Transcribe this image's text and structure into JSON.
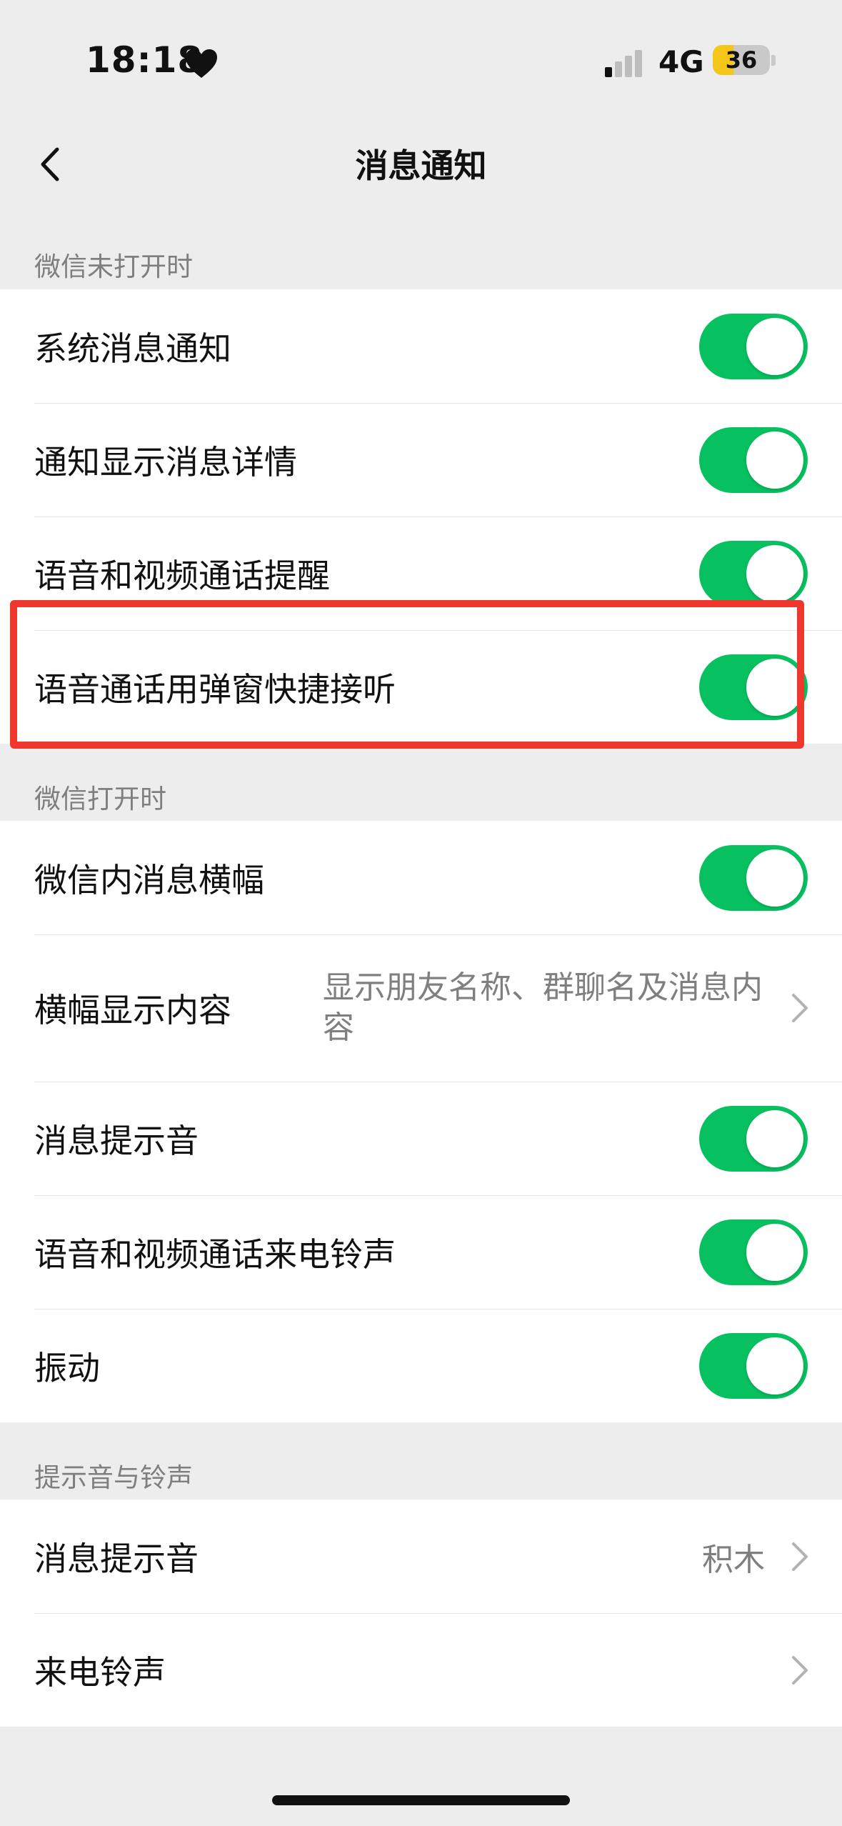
{
  "status_bar": {
    "time": "18:18",
    "network": "4G",
    "battery": "36",
    "battery_level": 0.36
  },
  "nav": {
    "title": "消息通知"
  },
  "sections": [
    {
      "header": "微信未打开时",
      "rows": [
        {
          "label": "系统消息通知",
          "toggle": true
        },
        {
          "label": "通知显示消息详情",
          "toggle": true
        },
        {
          "label": "语音和视频通话提醒",
          "toggle": true
        },
        {
          "label": "语音通话用弹窗快捷接听",
          "toggle": true
        }
      ]
    },
    {
      "header": "微信打开时",
      "rows": [
        {
          "label": "微信内消息横幅",
          "toggle": true
        },
        {
          "label": "横幅显示内容",
          "value": "显示朋友名称、群聊名及消息内容"
        },
        {
          "label": "消息提示音",
          "toggle": true
        },
        {
          "label": "语音和视频通话来电铃声",
          "toggle": true
        },
        {
          "label": "振动",
          "toggle": true
        }
      ]
    },
    {
      "header": "提示音与铃声",
      "rows": [
        {
          "label": "消息提示音",
          "value": "积木"
        },
        {
          "label": "来电铃声",
          "value": ""
        }
      ]
    }
  ],
  "colors": {
    "toggle_on": "#07C160",
    "annotation": "#F0372E",
    "background": "#EDEDED"
  }
}
